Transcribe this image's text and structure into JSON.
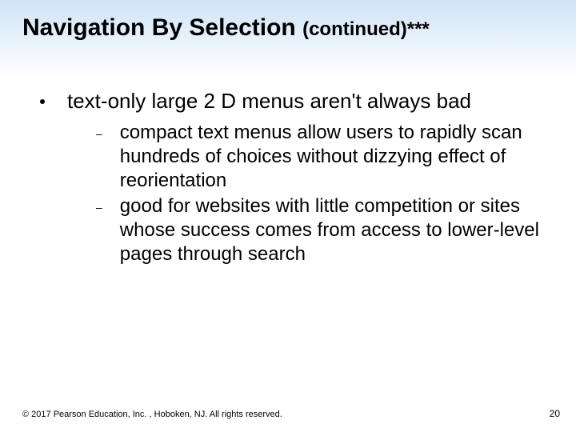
{
  "title": {
    "main": "Navigation By Selection ",
    "suffix": "(continued)***"
  },
  "bullets": [
    {
      "text": "text-only large 2 D menus aren't always bad",
      "subs": [
        "compact text menus allow users to rapidly scan hundreds of choices without dizzying effect of reorientation",
        "good for websites with little competition or sites whose success comes from access to lower-level pages through search"
      ]
    }
  ],
  "footer": "© 2017 Pearson Education, Inc. , Hoboken, NJ.  All rights reserved.",
  "page_number": "20"
}
